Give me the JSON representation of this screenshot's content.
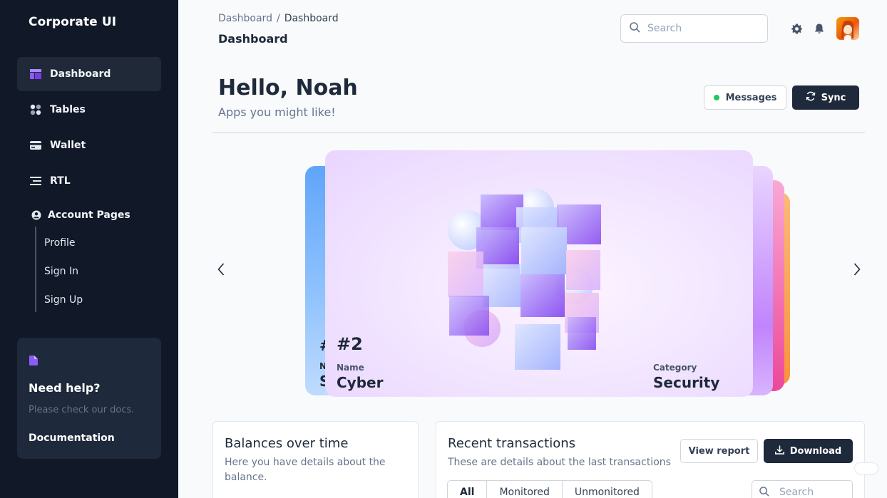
{
  "app": {
    "brand": "Corporate UI"
  },
  "sidebar": {
    "items": [
      {
        "label": "Dashboard",
        "icon": "dashboard-icon"
      },
      {
        "label": "Tables",
        "icon": "tables-icon"
      },
      {
        "label": "Wallet",
        "icon": "wallet-icon"
      },
      {
        "label": "RTL",
        "icon": "rtl-icon"
      },
      {
        "label": "Account Pages",
        "icon": "user-circle-icon"
      }
    ],
    "sub_items": [
      "Profile",
      "Sign In",
      "Sign Up"
    ],
    "help": {
      "title": "Need help?",
      "subtitle": "Please check our docs.",
      "link": "Documentation"
    }
  },
  "header": {
    "breadcrumb": [
      "Dashboard",
      "/",
      "Dashboard"
    ],
    "title": "Dashboard",
    "search_placeholder": "Search"
  },
  "hero": {
    "greeting": "Hello, Noah",
    "subtitle": "Apps you might like!",
    "messages_label": "Messages",
    "sync_label": "Sync",
    "status_color": "#22c55e"
  },
  "carousel": {
    "active_card": {
      "number": "#2",
      "name_label": "Name",
      "name": "Cyber",
      "category_label": "Category",
      "category": "Security"
    },
    "prev_card_peek": {
      "number": "#",
      "name_label": "N",
      "name": "S"
    }
  },
  "balances": {
    "title": "Balances over time",
    "subtitle": "Here you have details about the balance."
  },
  "transactions": {
    "title": "Recent transactions",
    "subtitle": "These are details about the last transactions",
    "view_report_label": "View report",
    "download_label": "Download",
    "tabs": [
      "All",
      "Monitored",
      "Unmonitored"
    ],
    "search_placeholder": "Search"
  },
  "colors": {
    "sidebar_bg": "#111827",
    "accent": "#8b5cf6",
    "dark_button": "#1e293b"
  }
}
